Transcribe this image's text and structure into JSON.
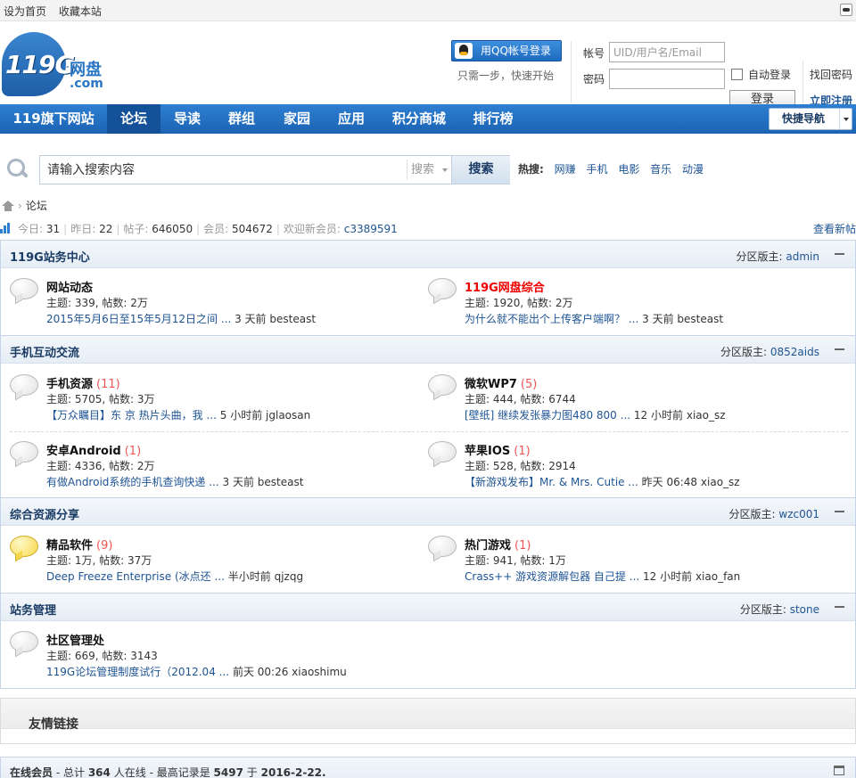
{
  "topbar": {
    "set_home": "设为首页",
    "bookmark": "收藏本站"
  },
  "logo": {
    "num": "119G",
    "wp": "网盘",
    "com": ".com"
  },
  "login": {
    "qq_button": "用QQ帐号登录",
    "qq_tip": "只需一步，快速开始",
    "account_label": "帐号",
    "account_placeholder": "UID/用户名/Email",
    "password_label": "密码",
    "auto_login": "自动登录",
    "login_button": "登录",
    "find_password": "找回密码",
    "register": "立即注册"
  },
  "nav": {
    "items": [
      "119旗下网站",
      "论坛",
      "导读",
      "群组",
      "家园",
      "应用",
      "积分商城",
      "排行榜"
    ],
    "active": "论坛",
    "quick_nav": "快捷导航"
  },
  "search": {
    "placeholder": "请输入搜索内容",
    "type": "搜索",
    "button": "搜索",
    "hot_label": "热搜:",
    "hot_words": [
      "网赚",
      "手机",
      "电影",
      "音乐",
      "动漫"
    ]
  },
  "breadcrumb": {
    "current": "论坛"
  },
  "stats": {
    "today_label": "今日:",
    "today": "31",
    "yesterday_label": "昨日:",
    "yesterday": "22",
    "posts_label": "帖子:",
    "posts": "646050",
    "members_label": "会员:",
    "members": "504672",
    "welcome_label": "欢迎新会员:",
    "new_member": "c3389591",
    "view_new": "查看新帖"
  },
  "sections": [
    {
      "title": "119G站务中心",
      "mod_label": "分区版主:",
      "mod": "admin",
      "forums": [
        {
          "name": "网站动态",
          "count": "",
          "stat": "主题: 339, 帖数: 2万",
          "last_title": "2015年5月6日至15年5月12日之间",
          "last_time": "3 天前",
          "last_user": "besteast",
          "new": false,
          "red": false
        },
        {
          "name": "119G网盘综合",
          "count": "",
          "stat": "主题: 1920, 帖数: 2万",
          "last_title": "为什么就不能出个上传客户端啊？",
          "last_time": "3 天前",
          "last_user": "besteast",
          "new": false,
          "red": true
        }
      ]
    },
    {
      "title": "手机互动交流",
      "mod_label": "分区版主:",
      "mod": "0852aids",
      "forums": [
        {
          "name": "手机资源",
          "count": "(11)",
          "stat": "主题: 5705, 帖数: 3万",
          "last_title": "【万众瞩目】东 京 热片头曲，我",
          "last_time": "5 小时前",
          "last_user": "jglaosan",
          "new": false,
          "red": false
        },
        {
          "name": "微软WP7",
          "count": "(5)",
          "stat": "主题: 444, 帖数: 6744",
          "last_title": "[壁纸] 继续发张暴力图480 800",
          "last_time": "12 小时前",
          "last_user": "xiao_sz",
          "new": false,
          "red": false
        },
        {
          "name": "安卓Android",
          "count": "(1)",
          "stat": "主题: 4336, 帖数: 2万",
          "last_title": "有做Android系统的手机查询快递",
          "last_time": "3 天前",
          "last_user": "besteast",
          "new": false,
          "red": false
        },
        {
          "name": "苹果IOS",
          "count": "(1)",
          "stat": "主题: 528, 帖数: 2914",
          "last_title": "【新游戏发布】Mr. & Mrs. Cutie",
          "last_time": "昨天 06:48",
          "last_user": "xiao_sz",
          "new": false,
          "red": false
        }
      ]
    },
    {
      "title": "综合资源分享",
      "mod_label": "分区版主:",
      "mod": "wzc001",
      "forums": [
        {
          "name": "精品软件",
          "count": "(9)",
          "stat": "主题: 1万, 帖数: 37万",
          "last_title": "Deep Freeze Enterprise (冰点还",
          "last_time": "半小时前",
          "last_user": "qjzqg",
          "new": true,
          "red": false
        },
        {
          "name": "热门游戏",
          "count": "(1)",
          "stat": "主题: 941, 帖数: 1万",
          "last_title": "Crass++ 游戏资源解包器 自己提",
          "last_time": "12 小时前",
          "last_user": "xiao_fan",
          "new": false,
          "red": false
        }
      ]
    },
    {
      "title": "站务管理",
      "mod_label": "分区版主:",
      "mod": "stone",
      "forums": [
        {
          "name": "社区管理处",
          "count": "",
          "stat": "主题: 669, 帖数: 3143",
          "last_title": "119G论坛管理制度试行（2012.04",
          "last_time": "前天 00:26",
          "last_user": "xiaoshimu",
          "new": false,
          "red": false
        }
      ]
    }
  ],
  "friends": {
    "title": "友情链接"
  },
  "online": {
    "title": "在线会员",
    "total_label": "- 总计",
    "total": "364",
    "online_suffix": "人在线",
    "record_label": "- 最高记录是",
    "record": "5497",
    "on": "于",
    "record_date": "2016-2-22."
  }
}
